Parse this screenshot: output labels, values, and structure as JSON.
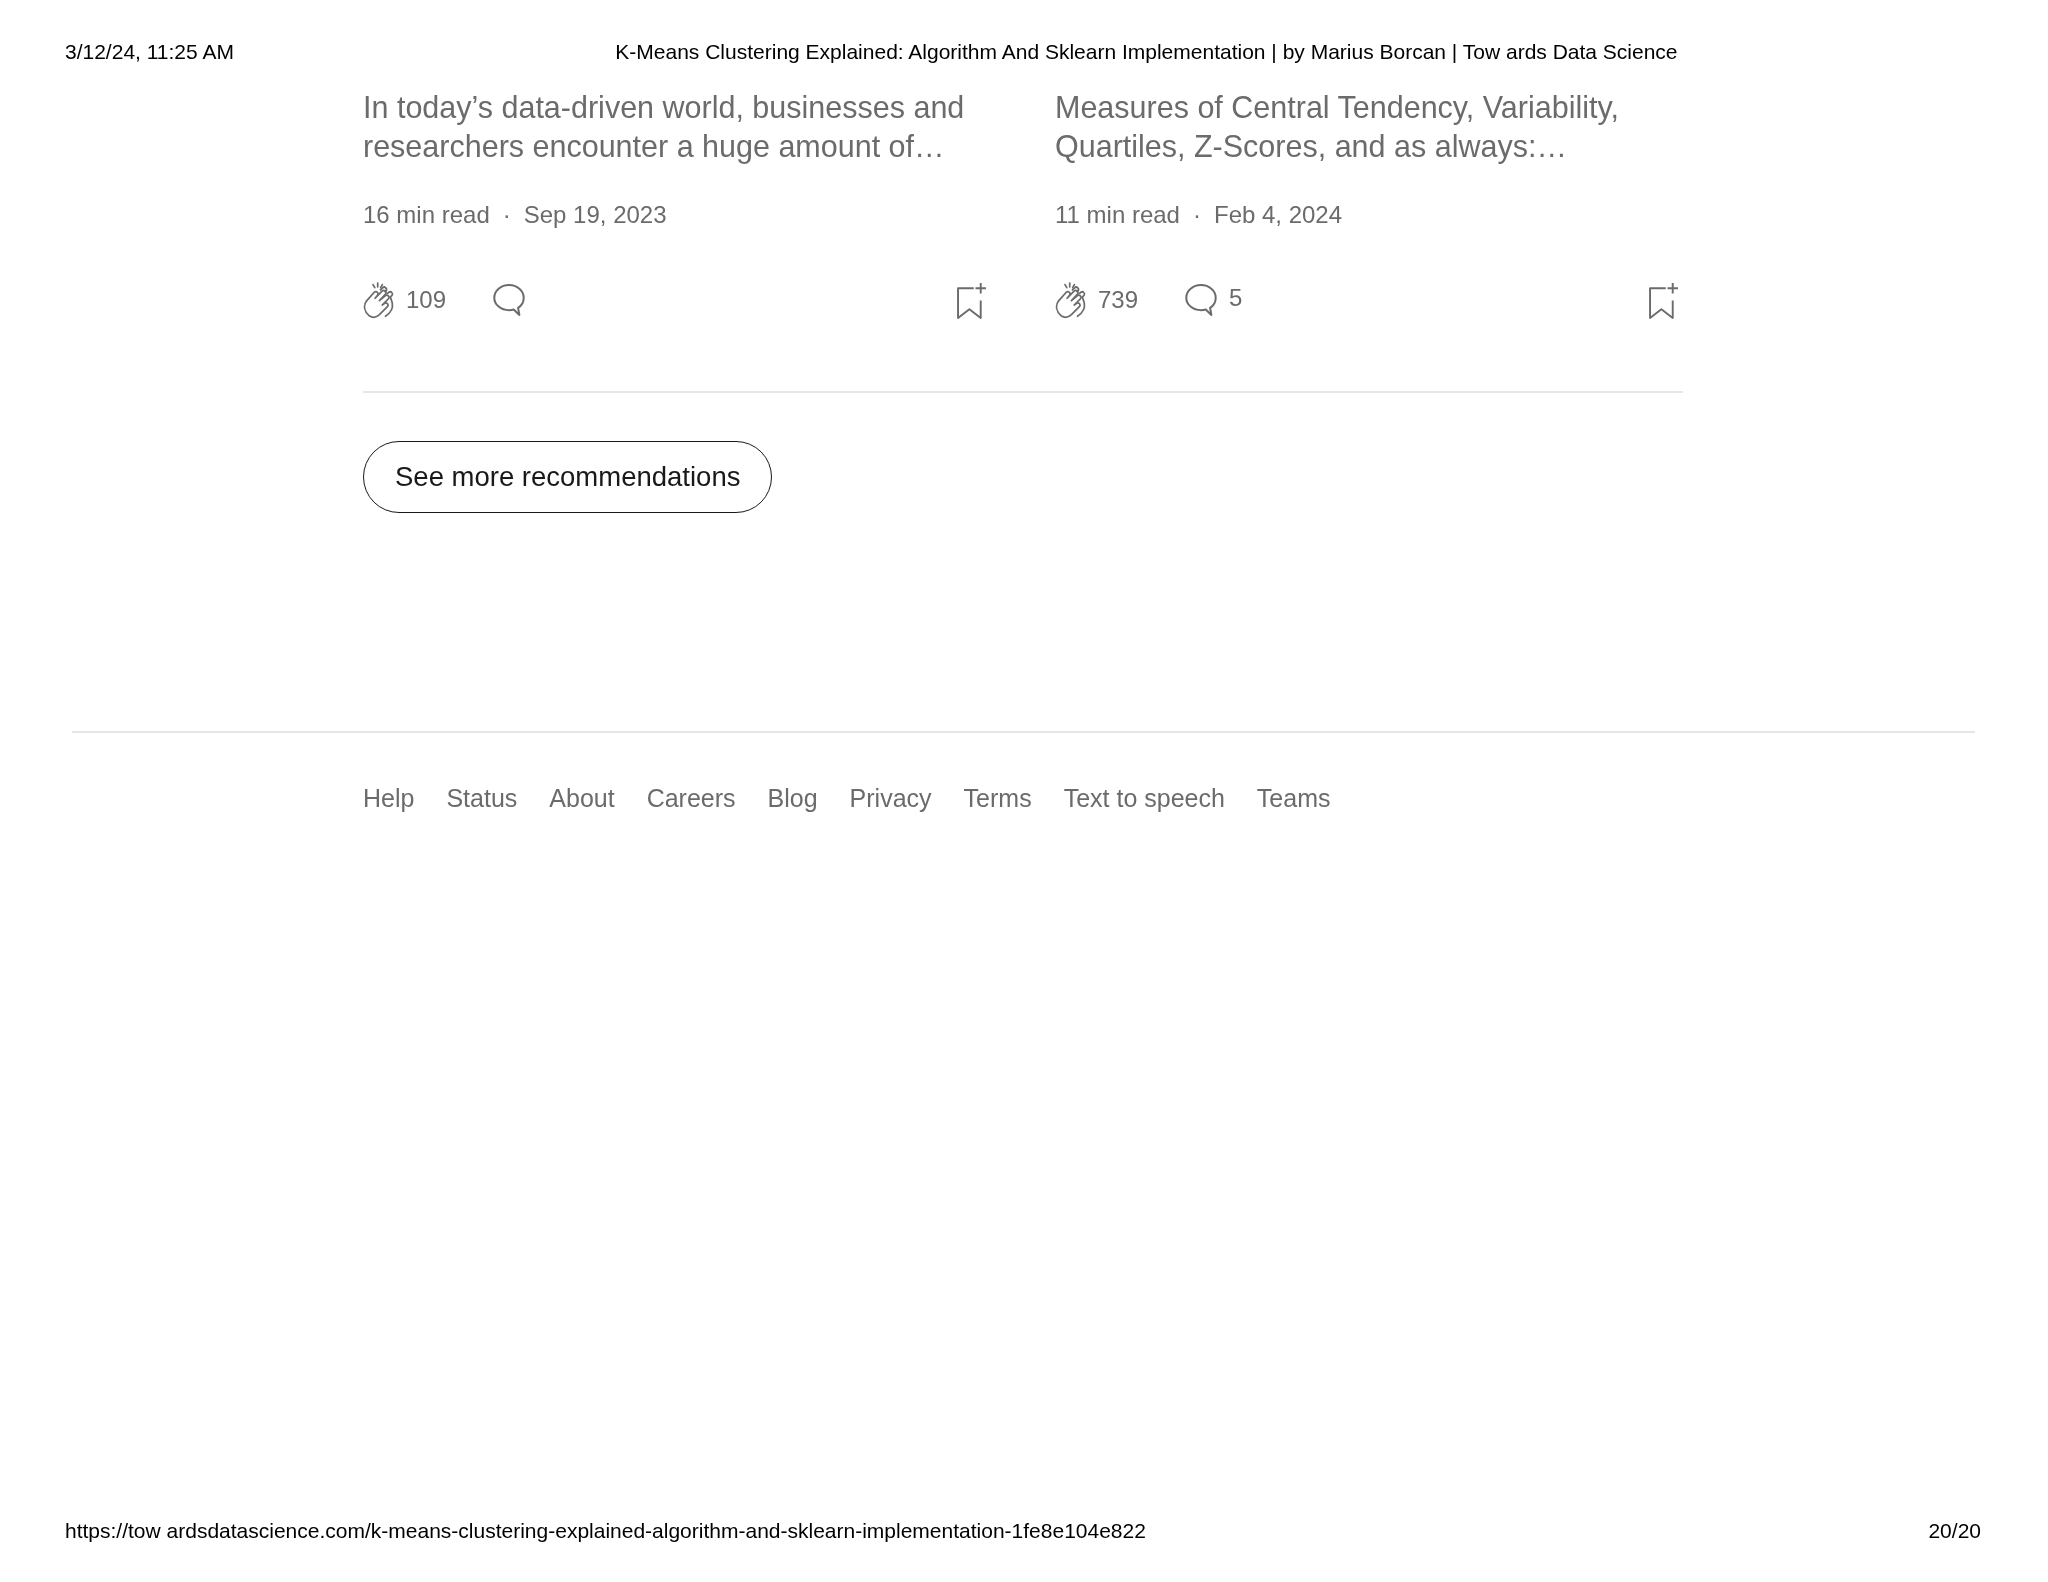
{
  "print_header": {
    "date": "3/12/24, 11:25 AM",
    "title": "K-Means Clustering Explained: Algorithm And Sklearn Implementation | by Marius Borcan | Tow ards Data Science"
  },
  "cards": [
    {
      "excerpt": "In today’s data-driven world, businesses and researchers encounter a huge amount of…",
      "read_time": "16 min read",
      "separator": "·",
      "date": "Sep 19, 2023",
      "claps": "109"
    },
    {
      "excerpt": "Measures of Central Tendency, Variability, Quartiles, Z-Scores, and as always:…",
      "read_time": "11 min read",
      "separator": "·",
      "date": "Feb 4, 2024",
      "claps": "739",
      "responses": "5"
    }
  ],
  "more_button": "See more recommendations",
  "footer_links": [
    "Help",
    "Status",
    "About",
    "Careers",
    "Blog",
    "Privacy",
    "Terms",
    "Text to speech",
    "Teams"
  ],
  "print_footer": {
    "url": "https://tow ardsdatascience.com/k-means-clustering-explained-algorithm-and-sklearn-implementation-1fe8e104e822",
    "page": "20/20"
  }
}
